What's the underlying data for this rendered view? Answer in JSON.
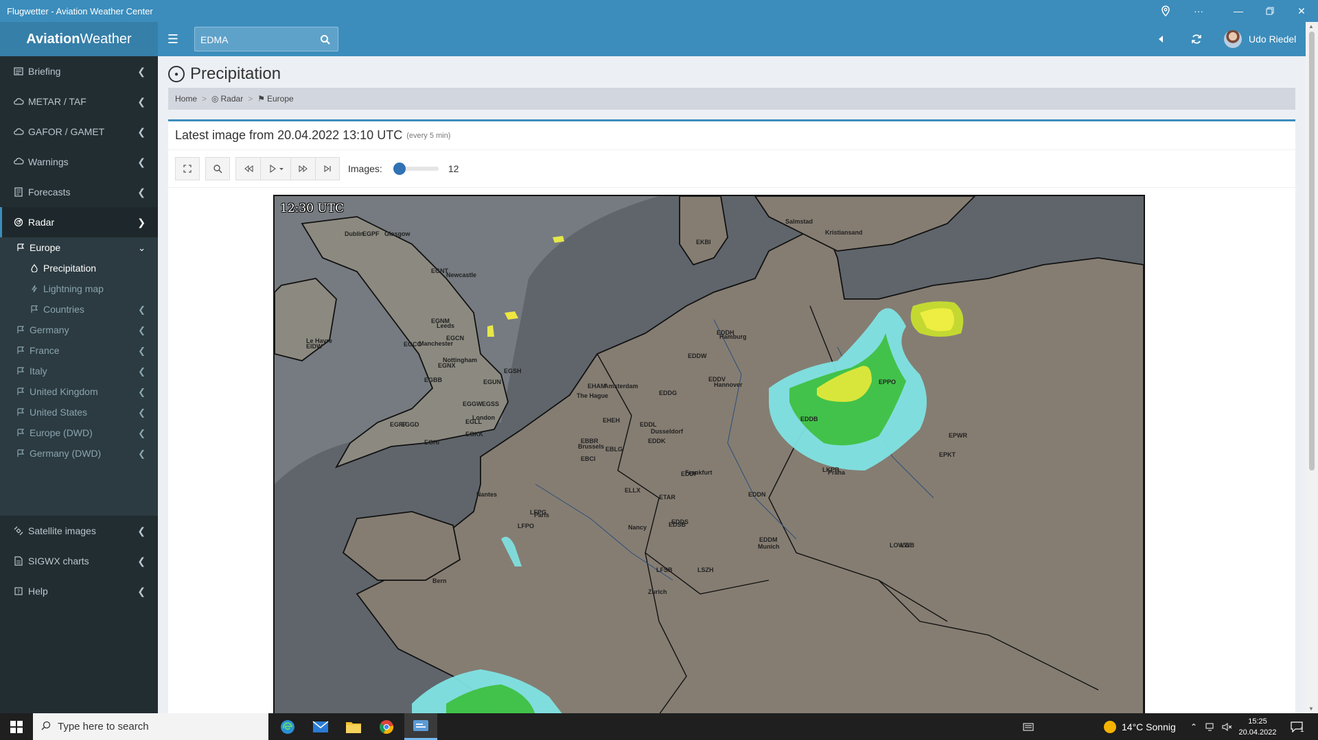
{
  "window": {
    "title": "Flugwetter - Aviation Weather Center"
  },
  "header": {
    "logo_bold": "Aviation",
    "logo_rest": "Weather",
    "search_value": "EDMA",
    "user_name": "Udo Riedel"
  },
  "sidebar": {
    "items": [
      {
        "label": "Briefing",
        "icon": "briefing-icon"
      },
      {
        "label": "METAR / TAF",
        "icon": "cloud-icon"
      },
      {
        "label": "GAFOR / GAMET",
        "icon": "cloud-icon"
      },
      {
        "label": "Warnings",
        "icon": "warning-icon"
      },
      {
        "label": "Forecasts",
        "icon": "forecast-icon"
      },
      {
        "label": "Radar",
        "icon": "radar-icon"
      }
    ],
    "radar_sub": [
      {
        "label": "Europe"
      },
      {
        "label": "Precipitation"
      },
      {
        "label": "Lightning map"
      },
      {
        "label": "Countries"
      },
      {
        "label": "Germany"
      },
      {
        "label": "France"
      },
      {
        "label": "Italy"
      },
      {
        "label": "United Kingdom"
      },
      {
        "label": "United States"
      },
      {
        "label": "Europe (DWD)"
      },
      {
        "label": "Germany (DWD)"
      }
    ],
    "bottom_items": [
      {
        "label": "Satellite images"
      },
      {
        "label": "SIGWX charts"
      },
      {
        "label": "Help"
      }
    ]
  },
  "page": {
    "title": "Precipitation",
    "breadcrumb": [
      "Home",
      "Radar",
      "Europe"
    ],
    "latest_label": "Latest image from 20.04.2022 13:10 UTC",
    "interval_label": "(every 5 min)",
    "images_label": "Images:",
    "images_count": "12",
    "map_time": "12:30 UTC"
  },
  "map_labels": [
    "EGPF",
    "Glasgow",
    "EGNT",
    "Newcastle",
    "EGNM",
    "Leeds",
    "EGCC",
    "Manchester",
    "EGCN",
    "EGNX",
    "Nottingham",
    "EGBB",
    "EGSH",
    "EGUN",
    "EGGW",
    "EGSS",
    "London",
    "EGLL",
    "EGKK",
    "EGGD",
    "EGFF",
    "EGHI",
    "EKBI",
    "Salmstad",
    "Kristiansand",
    "EDDH",
    "Hamburg",
    "EDDW",
    "EDDV",
    "Hannover",
    "EHAM",
    "Amsterdam",
    "The Hague",
    "EHEH",
    "EDDG",
    "EDDL",
    "Dusseldorf",
    "EDDK",
    "EBBR",
    "Brussels",
    "EBLG",
    "EBCI",
    "ELLX",
    "ETAR",
    "EDDF",
    "Frankfurt",
    "EDDN",
    "EDDS",
    "EDSB",
    "Nancy",
    "EDDM",
    "Munich",
    "LOWW",
    "LZIB",
    "Praha",
    "LKPR",
    "EPKT",
    "EPWR",
    "EPPO",
    "EDDB",
    "LFPG",
    "Paris",
    "LFPO",
    "LFSB",
    "LSZH",
    "Zurich",
    "Bern",
    "Nantes",
    "Le Havre",
    "EIDW",
    "Dublin",
    "Glasgow"
  ],
  "taskbar": {
    "search_placeholder": "Type here to search",
    "weather": "14°C  Sonnig",
    "time": "15:25",
    "date": "20.04.2022",
    "notification_count": "1"
  },
  "colors": {
    "brand": "#3c8dbc",
    "sidebar": "#222d32"
  }
}
